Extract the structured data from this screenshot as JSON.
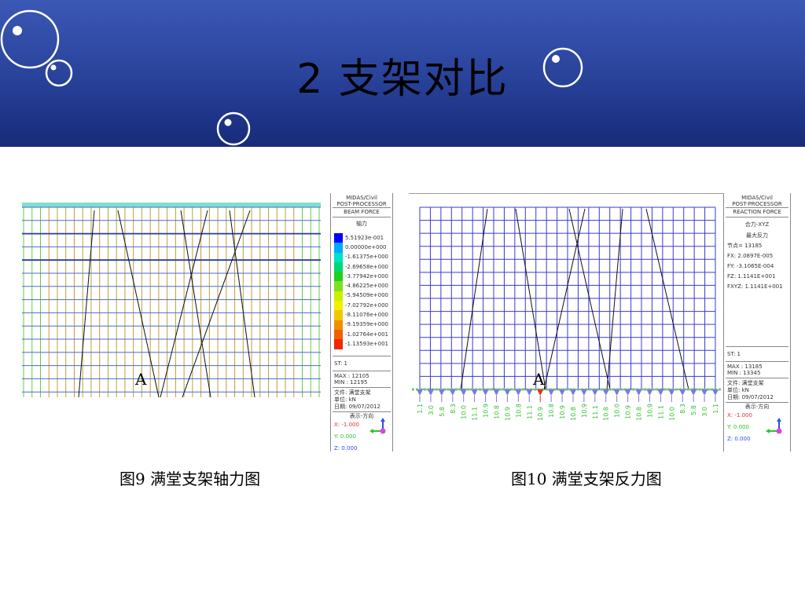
{
  "slide": {
    "title": "2 支架对比"
  },
  "figure_left": {
    "marker_label": "A",
    "caption": "图9 满堂支架轴力图",
    "legend": {
      "program": "MIDAS/Civil",
      "module": "POST-PROCESSOR",
      "result": "BEAM FORCE",
      "component": "轴力",
      "scale_values": [
        "5.51923e-001",
        "0.00000e+000",
        "-1.61375e+000",
        "-2.69658e+000",
        "-3.77942e+000",
        "-4.86225e+000",
        "-5.94509e+000",
        "-7.02792e+000",
        "-8.11076e+000",
        "-9.19359e+000",
        "-1.02764e+001",
        "-1.13593e+001"
      ],
      "scale_colors": [
        "#0000ff",
        "#00a8ff",
        "#00e0c8",
        "#00d870",
        "#20d020",
        "#80e020",
        "#c8f000",
        "#f0f000",
        "#f0c800",
        "#f09000",
        "#f06000",
        "#f02800"
      ],
      "st": "ST: 1",
      "max": "MAX : 12105",
      "min": "MIN : 12195",
      "file": "文件: 满堂支架",
      "unit": "单位: kN",
      "date": "日期: 09/07/2012",
      "view": "表示-方向",
      "x": "X: -1.000",
      "y": "Y: 0.000",
      "z": "Z: 0.000"
    }
  },
  "figure_right": {
    "marker_label": "A",
    "caption": "图10 满堂支架反力图",
    "reaction_labels": [
      "1.1",
      "3.0",
      "5.8",
      "8.3",
      "10.0",
      "11.1",
      "10.9",
      "10.8",
      "10.9",
      "10.8",
      "11.1",
      "10.9",
      "10.8",
      "10.9",
      "10.8",
      "10.9",
      "11.1",
      "10.8",
      "10.0",
      "10.9",
      "10.8",
      "10.9",
      "11.1",
      "10.0",
      "8.3",
      "5.8",
      "3.0",
      "1.1"
    ],
    "legend": {
      "program": "MIDAS/Civil",
      "module": "POST-PROCESSOR",
      "result": "REACTION FORCE",
      "component": "合力-XYZ",
      "subtitle": "最大反力",
      "node": "节点= 13185",
      "fx": "FX:   2.0897E-005",
      "fy": "FY:   -3.1065E-004",
      "fz": "FZ:   1.1141E+001",
      "fxyz": "FXYZ: 1.1141E+001",
      "st": "ST: 1",
      "max": "MAX : 13185",
      "min": "MIN : 13345",
      "file": "文件: 满堂支架",
      "unit": "单位: kN",
      "date": "日期: 09/07/2012",
      "view": "表示-方向",
      "x": "X: -1.000",
      "y": "Y: 0.000",
      "z": "Z: 0.000"
    }
  }
}
